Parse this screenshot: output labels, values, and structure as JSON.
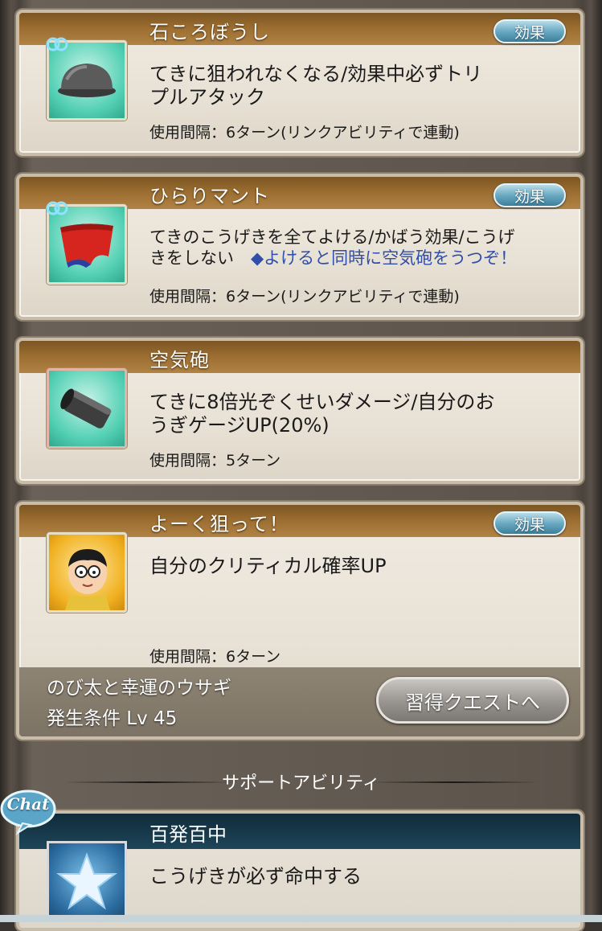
{
  "abilities": [
    {
      "title": "石ころぼうし",
      "effect_label": "効果",
      "desc_line1": "てきに狙われなくなる/効果中必ずトリ",
      "desc_line2": "プルアタック",
      "usage": "使用間隔：6ターン(リンクアビリティで連動)",
      "icon": "stone-hat-icon",
      "linked": true
    },
    {
      "title": "ひらりマント",
      "effect_label": "効果",
      "desc_line1": "てきのこうげきを全てよける/かばう効果/こうげ",
      "desc_line2_plain": "きをしない　",
      "desc_line2_blue": "◆よけると同時に空気砲をうつぞ！",
      "usage": "使用間隔：6ターン(リンクアビリティで連動)",
      "icon": "cape-icon",
      "linked": true
    },
    {
      "title": "空気砲",
      "desc_line1": "てきに8倍光ぞくせいダメージ/自分のお",
      "desc_line2": "うぎゲージUP(20%)",
      "usage": "使用間隔：5ターン",
      "icon": "air-cannon-icon",
      "linked": false
    },
    {
      "title": "よーく狙って！",
      "effect_label": "効果",
      "desc_line1": "自分のクリティカル確率UP",
      "usage": "使用間隔：6ターン",
      "icon": "nobita-portrait-icon",
      "quest_name": "のび太と幸運のウサギ",
      "quest_condition": "発生条件 Lv 45",
      "quest_button": "習得クエストへ"
    }
  ],
  "support_section_label": "サポートアビリティ",
  "support": {
    "title": "百発百中",
    "desc": "こうげきが必ず命中する",
    "icon": "star-icon"
  },
  "chat_label": "Chat",
  "colors": {
    "header_brown": "#9a6c30",
    "effect_button": "#6aa9c2",
    "support_header": "#1e4559",
    "link_blue": "#2f4fa8"
  }
}
